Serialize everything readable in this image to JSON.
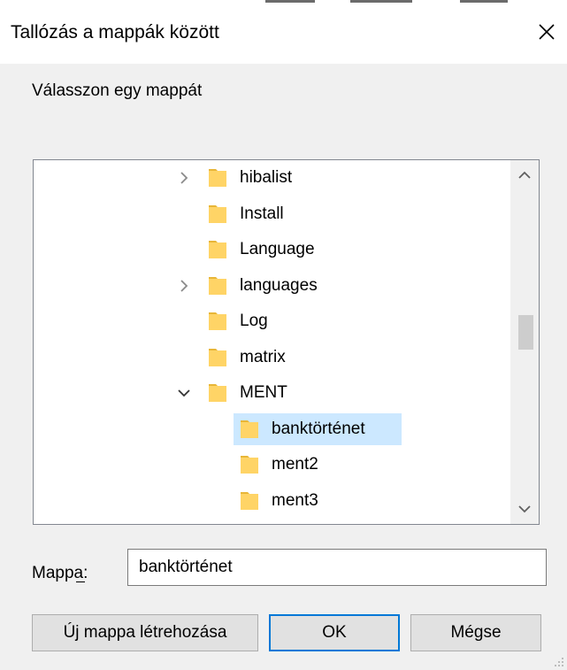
{
  "dialog": {
    "title": "Tallózás a mappák között",
    "prompt": "Válasszon egy mappát"
  },
  "tree": {
    "items": [
      {
        "label": "hibalist",
        "expander": "collapsed",
        "level": 1,
        "selected": false
      },
      {
        "label": "Install",
        "expander": "none",
        "level": 1,
        "selected": false
      },
      {
        "label": "Language",
        "expander": "none",
        "level": 1,
        "selected": false
      },
      {
        "label": "languages",
        "expander": "collapsed",
        "level": 1,
        "selected": false
      },
      {
        "label": "Log",
        "expander": "none",
        "level": 1,
        "selected": false
      },
      {
        "label": "matrix",
        "expander": "none",
        "level": 1,
        "selected": false
      },
      {
        "label": "MENT",
        "expander": "expanded",
        "level": 1,
        "selected": false
      },
      {
        "label": "banktörténet",
        "expander": "none",
        "level": 2,
        "selected": true
      },
      {
        "label": "ment2",
        "expander": "none",
        "level": 2,
        "selected": false
      },
      {
        "label": "ment3",
        "expander": "none",
        "level": 2,
        "selected": false
      },
      {
        "label": "",
        "expander": "none",
        "level": 2,
        "selected": false
      }
    ]
  },
  "folder_field": {
    "label": "Mappa:",
    "value": "banktörténet"
  },
  "buttons": {
    "new_folder": "Új mappa létrehozása",
    "ok": "OK",
    "cancel": "Mégse"
  },
  "colors": {
    "selection": "#cce8ff",
    "folder": "#ffd466",
    "folder_dark": "#e8b637",
    "ok_border": "#0078d7",
    "dialog_bg": "#f0f0f0"
  }
}
